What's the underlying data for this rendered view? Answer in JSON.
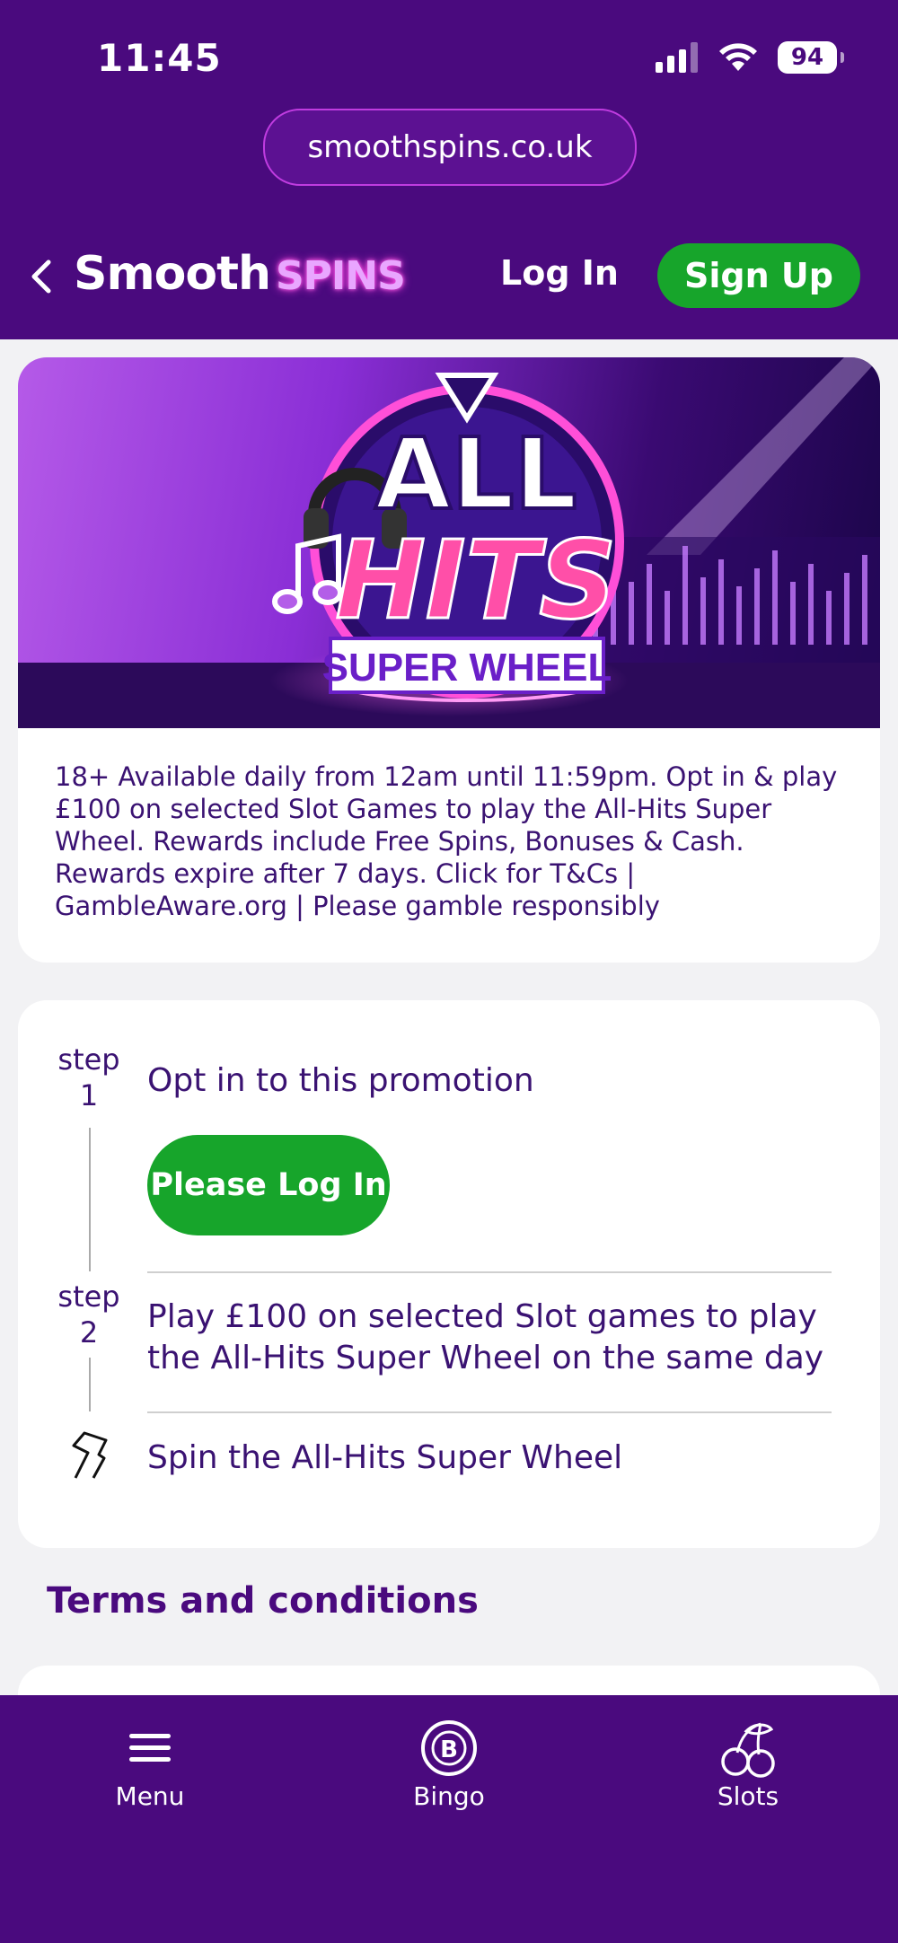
{
  "status_bar": {
    "time": "11:45",
    "battery": "94"
  },
  "browser": {
    "url": "smoothspins.co.uk"
  },
  "header": {
    "logo_smooth": "Smooth",
    "logo_spins": "SPINS",
    "login_label": "Log In",
    "signup_label": "Sign Up"
  },
  "banner": {
    "title_line1": "ALL",
    "title_line2": "HITS",
    "subtitle": "SUPER WHEEL"
  },
  "promo": {
    "text": "18+ Available daily from 12am until 11:59pm. Opt in & play £100 on selected Slot Games to play the All-Hits Super Wheel. Rewards include Free Spins, Bonuses & Cash. Rewards expire after 7 days. Click for T&Cs | GambleAware.org | Please gamble responsibly"
  },
  "steps": [
    {
      "label": "step",
      "number": "1",
      "text": "Opt in to this promotion",
      "button": "Please Log In"
    },
    {
      "label": "step",
      "number": "2",
      "text": "Play £100 on selected Slot games to play the All-Hits Super Wheel on the same day"
    },
    {
      "text": "Spin the All-Hits Super Wheel"
    }
  ],
  "terms": {
    "heading": "Terms and conditions"
  },
  "bottom_nav": [
    {
      "label": "Menu",
      "icon": "menu-icon"
    },
    {
      "label": "Bingo",
      "icon": "bingo-icon"
    },
    {
      "label": "Slots",
      "icon": "cherries-icon"
    }
  ],
  "colors": {
    "brand_purple": "#4a0a7e",
    "accent_green": "#17a52b",
    "text_purple": "#3a1272"
  }
}
